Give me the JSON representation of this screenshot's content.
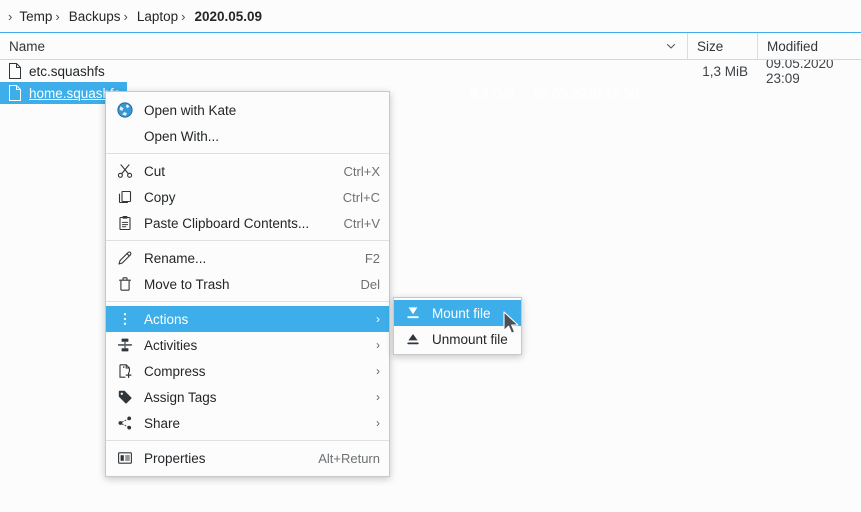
{
  "breadcrumb": {
    "separator": "›",
    "items": [
      {
        "label": "Temp",
        "bold": false
      },
      {
        "label": "Backups",
        "bold": false
      },
      {
        "label": "Laptop",
        "bold": false
      },
      {
        "label": "2020.05.09",
        "bold": true
      }
    ]
  },
  "columns": {
    "name": "Name",
    "size": "Size",
    "modified": "Modified",
    "sort_icon": "chevron-down-icon"
  },
  "files": [
    {
      "name": "etc.squashfs",
      "size": "1,3 MiB",
      "modified": "09.05.2020 23:09",
      "icon": "document-icon",
      "selected": false
    },
    {
      "name": "home.squashfs",
      "size": "8,8 GiB",
      "modified": "09.05.2020 22:50",
      "icon": "document-icon",
      "selected": true
    }
  ],
  "context_menu": {
    "items": [
      {
        "label": "Open with Kate",
        "icon": "kate-app-icon",
        "shortcut": "",
        "submenu": false,
        "highlight": false
      },
      {
        "label": "Open With...",
        "icon": "",
        "shortcut": "",
        "submenu": false,
        "highlight": false
      },
      {
        "separator": true
      },
      {
        "label": "Cut",
        "icon": "scissors-icon",
        "shortcut": "Ctrl+X",
        "submenu": false,
        "highlight": false
      },
      {
        "label": "Copy",
        "icon": "copy-icon",
        "shortcut": "Ctrl+C",
        "submenu": false,
        "highlight": false
      },
      {
        "label": "Paste Clipboard Contents...",
        "icon": "clipboard-icon",
        "shortcut": "Ctrl+V",
        "submenu": false,
        "highlight": false
      },
      {
        "separator": true
      },
      {
        "label": "Rename...",
        "icon": "pencil-icon",
        "shortcut": "F2",
        "submenu": false,
        "highlight": false
      },
      {
        "label": "Move to Trash",
        "icon": "trash-icon",
        "shortcut": "Del",
        "submenu": false,
        "highlight": false
      },
      {
        "separator": true
      },
      {
        "label": "Actions",
        "icon": "dots-vertical-icon",
        "shortcut": "",
        "submenu": true,
        "highlight": true
      },
      {
        "label": "Activities",
        "icon": "activities-icon",
        "shortcut": "",
        "submenu": true,
        "highlight": false
      },
      {
        "label": "Compress",
        "icon": "compress-icon",
        "shortcut": "",
        "submenu": true,
        "highlight": false
      },
      {
        "label": "Assign Tags",
        "icon": "tag-icon",
        "shortcut": "",
        "submenu": true,
        "highlight": false
      },
      {
        "label": "Share",
        "icon": "share-icon",
        "shortcut": "",
        "submenu": true,
        "highlight": false
      },
      {
        "separator": true
      },
      {
        "label": "Properties",
        "icon": "properties-icon",
        "shortcut": "Alt+Return",
        "submenu": false,
        "highlight": false
      }
    ],
    "submenu_arrow": "›"
  },
  "submenu": {
    "items": [
      {
        "label": "Mount file",
        "icon": "mount-icon",
        "highlight": true
      },
      {
        "label": "Unmount file",
        "icon": "eject-icon",
        "highlight": false
      }
    ]
  },
  "colors": {
    "highlight": "#3daee9",
    "background": "#fcfcfc",
    "text": "#232629",
    "shortcut_text": "#6e7173"
  }
}
